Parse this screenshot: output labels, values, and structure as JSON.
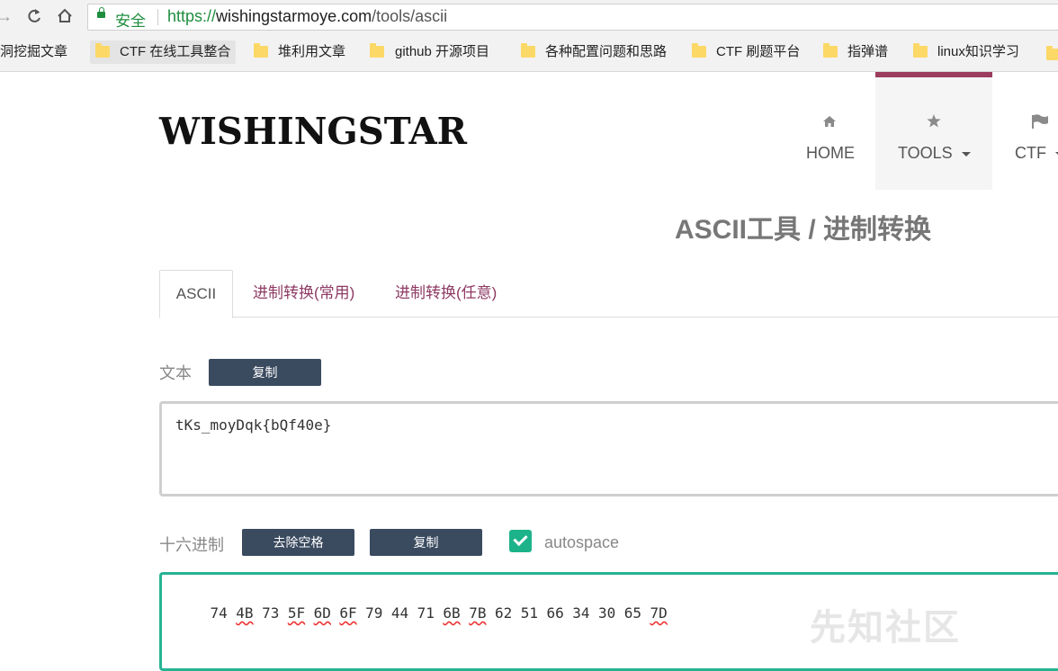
{
  "browser": {
    "secure_label": "安全",
    "url_scheme": "https://",
    "url_host": "wishingstarmoye.com",
    "url_path": "/tools/ascii"
  },
  "bookmarks": [
    {
      "label": "洞挖掘文章"
    },
    {
      "label": "CTF 在线工具整合"
    },
    {
      "label": "堆利用文章"
    },
    {
      "label": "github 开源项目"
    },
    {
      "label": "各种配置问题和思路"
    },
    {
      "label": "CTF 刷题平台"
    },
    {
      "label": "指弹谱"
    },
    {
      "label": "linux知识学习"
    }
  ],
  "site": {
    "logo": "WISHINGSTAR",
    "nav": [
      {
        "label": "HOME",
        "icon": "home-icon"
      },
      {
        "label": "TOOLS",
        "icon": "star-icon"
      },
      {
        "label": "CTF",
        "icon": "flag-icon"
      }
    ]
  },
  "page": {
    "title": "ASCII工具 / 进制转换",
    "tabs": [
      "ASCII",
      "进制转换(常用)",
      "进制转换(任意)"
    ],
    "text_label": "文本",
    "copy_label": "复制",
    "text_value": "tKs_moyDqk{bQf40e}",
    "hex_label": "十六进制",
    "remove_spaces_label": "去除空格",
    "copy_label_2": "复制",
    "autospace_label": "autospace",
    "autospace_checked": true,
    "hex_tokens": [
      "74",
      "4B",
      "73",
      "5F",
      "6D",
      "6F",
      "79",
      "44",
      "71",
      "6B",
      "7B",
      "62",
      "51",
      "66",
      "34",
      "30",
      "65",
      "7D"
    ]
  },
  "watermark": "先知社区",
  "colors": {
    "accent": "#9c3c5e",
    "button": "#3a4a5f",
    "focus": "#27b394",
    "checkbox": "#1cb38a"
  }
}
